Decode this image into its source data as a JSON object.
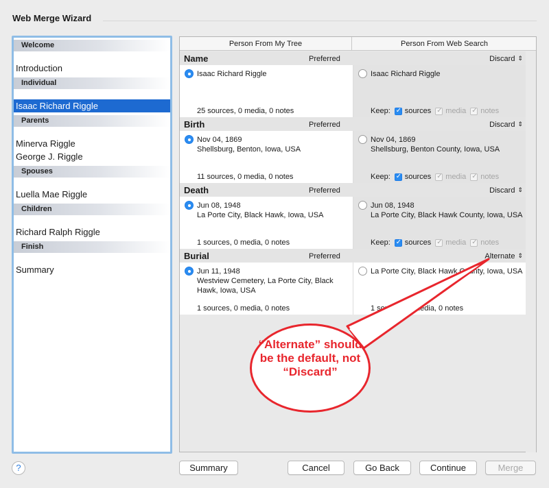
{
  "window": {
    "title": "Web Merge Wizard"
  },
  "sidebar": {
    "sections": [
      {
        "heading": "Welcome",
        "items": [
          "Introduction"
        ]
      },
      {
        "heading": "Individual",
        "items": [
          "Isaac Richard Riggle"
        ]
      },
      {
        "heading": "Parents",
        "items": [
          "Minerva Riggle",
          "George J. Riggle"
        ]
      },
      {
        "heading": "Spouses",
        "items": [
          "Luella Mae Riggle"
        ]
      },
      {
        "heading": "Children",
        "items": [
          "Richard Ralph Riggle"
        ]
      },
      {
        "heading": "Finish",
        "items": [
          "Summary"
        ]
      }
    ],
    "selected_item": "Isaac Richard Riggle"
  },
  "columns": {
    "left": "Person From My Tree",
    "right": "Person From Web Search"
  },
  "preferred_label": "Preferred",
  "keep": {
    "label": "Keep:",
    "sources": "sources",
    "media": "media",
    "notes": "notes"
  },
  "sections": [
    {
      "title": "Name",
      "action": "Discard",
      "left": {
        "text": "Isaac Richard Riggle",
        "stats": "25 sources, 0 media, 0 notes",
        "selected": true
      },
      "right": {
        "text": "Isaac Richard Riggle",
        "selected": false,
        "show_keep": true
      }
    },
    {
      "title": "Birth",
      "action": "Discard",
      "left": {
        "text": "Nov 04, 1869\nShellsburg, Benton, Iowa, USA",
        "stats": "11 sources, 0 media, 0 notes",
        "selected": true
      },
      "right": {
        "text": "Nov 04, 1869\nShellsburg, Benton County, Iowa, USA",
        "selected": false,
        "show_keep": true
      }
    },
    {
      "title": "Death",
      "action": "Discard",
      "left": {
        "text": "Jun 08, 1948\nLa Porte City, Black Hawk, Iowa, USA",
        "stats": "1 sources, 0 media, 0 notes",
        "selected": true
      },
      "right": {
        "text": "Jun 08, 1948\nLa Porte City, Black Hawk County, Iowa, USA",
        "selected": false,
        "show_keep": true
      }
    },
    {
      "title": "Burial",
      "action": "Alternate",
      "left": {
        "text": "Jun 11, 1948\nWestview Cemetery, La Porte City, Black Hawk, Iowa, USA",
        "stats": "1 sources, 0 media, 0 notes",
        "selected": true
      },
      "right": {
        "text": "La Porte City, Black Hawk County, Iowa, USA",
        "stats": "1 sources, 0 media, 0 notes",
        "selected": false,
        "show_keep": false
      }
    }
  ],
  "callout": {
    "text": "“Alternate” should be the default, not “Discard”",
    "color": "#e8262d"
  },
  "buttons": {
    "help": "?",
    "summary": "Summary",
    "cancel": "Cancel",
    "go_back": "Go Back",
    "continue": "Continue",
    "merge": "Merge"
  },
  "colors": {
    "selection": "#1d6ad1",
    "sidebar_border": "#8fbde6",
    "radio_on": "#2b8cf0"
  }
}
